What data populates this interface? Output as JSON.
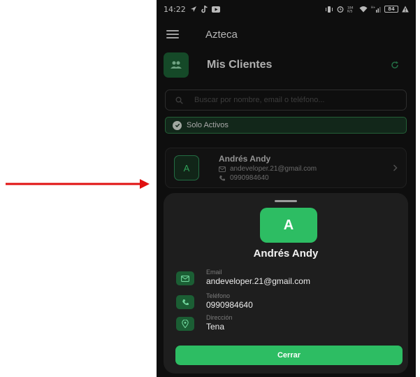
{
  "annotation": {
    "arrow_color": "#e01010"
  },
  "status_bar": {
    "time": "14:22",
    "left_icons": [
      "location-arrow-icon",
      "tiktok-icon",
      "youtube-icon"
    ],
    "right_icons": [
      "vibrate-icon",
      "alarm-icon",
      "data-speed-icon",
      "wifi-icon",
      "signal-icon",
      "battery-icon",
      "warning-icon"
    ],
    "data_speed": "184\nK/S",
    "battery_level": "84"
  },
  "app_bar": {
    "title": "Azteca",
    "menu_icon": "hamburger-menu-icon"
  },
  "header": {
    "title": "Mis Clientes",
    "icon": "group-icon",
    "refresh_icon": "refresh-icon"
  },
  "search": {
    "placeholder": "Buscar por nombre, email o teléfono...",
    "value": ""
  },
  "filter": {
    "label": "Solo Activos",
    "checked": true
  },
  "client_list": [
    {
      "initial": "A",
      "name": "Andrés Andy",
      "email": "andeveloper.21@gmail.com",
      "phone": "0990984640"
    }
  ],
  "sheet": {
    "initial": "A",
    "name": "Andrés Andy",
    "email_label": "Email",
    "email": "andeveloper.21@gmail.com",
    "phone_label": "Teléfono",
    "phone": "0990984640",
    "address_label": "Dirección",
    "address": "Tena",
    "close_label": "Cerrar"
  },
  "colors": {
    "background": "#121212",
    "accent": "#2dbd63",
    "accent_dark": "#1b5e34",
    "surface": "#1e1e1e"
  }
}
